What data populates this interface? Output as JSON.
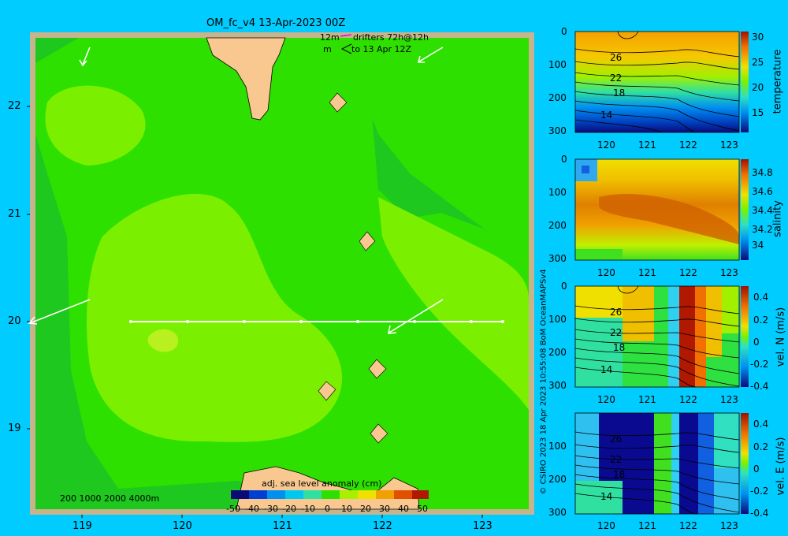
{
  "title": "OM_fc_v4  13-Apr-2023 00Z",
  "legend_drifters": {
    "line1": "12m",
    "line2": "m",
    "label1": "drifters 72h@12h",
    "label2": "to 13 Apr 12Z"
  },
  "map": {
    "lat_ticks": [
      "22",
      "21",
      "20",
      "19"
    ],
    "lon_ticks": [
      "119",
      "120",
      "121",
      "122",
      "123"
    ],
    "depth_legend": "200  1000  2000  4000m",
    "colorbar_title": "adj. sea level anomaly (cm)",
    "colorbar_ticks": [
      "-50",
      "-40",
      "-30",
      "-20",
      "-10",
      "0",
      "10",
      "20",
      "30",
      "40",
      "50"
    ],
    "colors": {
      "ocean_deep": "#1ec81e",
      "ocean_mid": "#2ee000",
      "ocean_high": "#7af000",
      "land": "#f8c890",
      "frame": "#c8b48c"
    }
  },
  "copyright": "© CSIRO 2023   18 Apr 2023 10:55:08 BoM OceanMAPSv4",
  "panels": [
    {
      "name": "temperature",
      "ylabel": "temperature",
      "depth_ticks": [
        "0",
        "100",
        "200",
        "300"
      ],
      "lon_ticks": [
        "120",
        "121",
        "122",
        "123"
      ],
      "cbar_ticks": [
        "30",
        "25",
        "20",
        "15"
      ],
      "contour_labels": [
        "26",
        "22",
        "18",
        "14"
      ]
    },
    {
      "name": "salinity",
      "ylabel": "salinity",
      "depth_ticks": [
        "0",
        "100",
        "200",
        "300"
      ],
      "lon_ticks": [
        "120",
        "121",
        "122",
        "123"
      ],
      "cbar_ticks": [
        "34.8",
        "34.6",
        "34.4",
        "34.2",
        "34"
      ]
    },
    {
      "name": "vel_n",
      "ylabel": "vel. N (m/s)",
      "depth_ticks": [
        "0",
        "100",
        "200",
        "300"
      ],
      "lon_ticks": [
        "120",
        "121",
        "122",
        "123"
      ],
      "cbar_ticks": [
        "0.4",
        "0.2",
        "0",
        "-0.2",
        "-0.4"
      ],
      "contour_labels": [
        "26",
        "22",
        "18",
        "14"
      ]
    },
    {
      "name": "vel_e",
      "ylabel": "vel. E (m/s)",
      "depth_ticks": [
        "0",
        "100",
        "200",
        "300"
      ],
      "lon_ticks": [
        "120",
        "121",
        "122",
        "123"
      ],
      "cbar_ticks": [
        "0.4",
        "0.2",
        "0",
        "-0.2",
        "-0.4"
      ],
      "contour_labels": [
        "26",
        "22",
        "18",
        "14"
      ]
    }
  ]
}
